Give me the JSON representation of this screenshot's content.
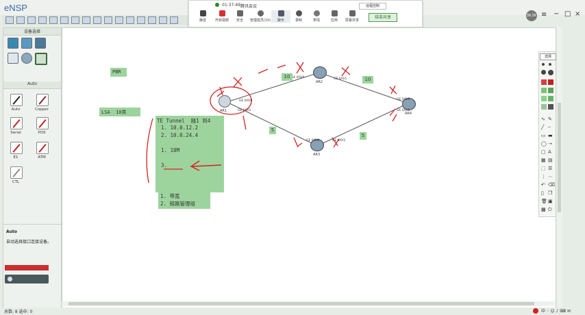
{
  "app": {
    "title": "eNSP"
  },
  "meeting": {
    "time": "01:37:49",
    "name": "腾讯会议",
    "items": [
      "静音",
      "开启视频",
      "安全",
      "管理成员(10)",
      "聊天",
      "录制",
      "表情",
      "应用",
      "屏幕共享"
    ],
    "remote_label": "远程控制",
    "end_label": "结束共享"
  },
  "corner": {
    "ping": "36.5K"
  },
  "left_panel": {
    "header1": "设备选择",
    "header2": "Auto",
    "cables": [
      {
        "label": "Auto",
        "color": "#222222"
      },
      {
        "label": "Copper",
        "color": "#7a2a2a"
      },
      {
        "label": "Serial",
        "color": "#c02020"
      },
      {
        "label": "POS",
        "color": "#c02020"
      },
      {
        "label": "E1",
        "color": "#c02020"
      },
      {
        "label": "ATM",
        "color": "#c02020"
      },
      {
        "label": "CTL",
        "color": "#8a8a8a"
      }
    ],
    "desc_title": "Auto",
    "desc_text": "自动选择接口连接设备。"
  },
  "canvas": {
    "notes": {
      "pbr": "PBR",
      "lsa": "LSA  10类",
      "te_title": "TE Tunnel  隧1 到4",
      "te_l1": "1. 10.0.12.2",
      "te_l2": "2. 10.0.24.4",
      "te_l3": "1. 10M",
      "te_l4": "3.",
      "foot_l1": "1. 带宽",
      "foot_l2": "2. 链路管理组"
    },
    "routers": [
      {
        "name": "AR1"
      },
      {
        "name": "AR2"
      },
      {
        "name": "AR3"
      },
      {
        "name": "AR4"
      }
    ],
    "ports": {
      "ar1_top": "GE 0/0/0",
      "ar1_bot": "GE 0/0/1",
      "ar2_left": "GE 0/0/0",
      "ar2_right": "GE 0/0/1",
      "ar3_left": "GE 0/0/0",
      "ar3_right": "GE 0/0/1",
      "ar4_top": "GE 0/0/0",
      "ar4_bot": "GE 0/0/1"
    },
    "costs": [
      "10",
      "10",
      "5",
      "5"
    ]
  },
  "palette": {
    "header": "选择"
  },
  "status": {
    "text": "总数: 8 选中: 0"
  },
  "colors": {
    "note_bg": "#9dd49d",
    "ink": "#d42020",
    "link": "#555555"
  }
}
